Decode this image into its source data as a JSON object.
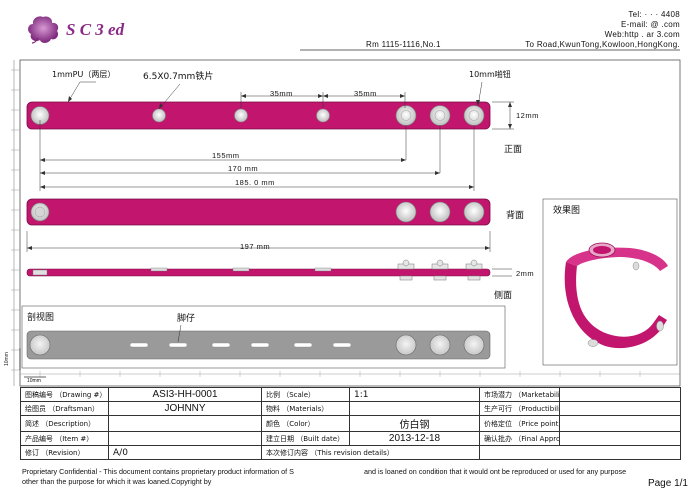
{
  "header": {
    "brand": "S        C  3    ed",
    "tel": "Tel:  ·  · ·        4408",
    "email": "E-mail:    @    .com",
    "web": "Web:http    .      ar     3.com",
    "address_room": "Rm 1115-1116,No.1",
    "address_road": "To Road,KwunTong,Kowloon,HongKong."
  },
  "drawing": {
    "label_pu": "1mmPU（两层）",
    "label_plate": "6.5X0.7mm铁片",
    "label_button": "10mm啪钮",
    "dim_35a": "35mm",
    "dim_35b": "35mm",
    "dim_12": "12mm",
    "dim_155": "155mm",
    "dim_170": "170 mm",
    "dim_185": "185. 0 mm",
    "dim_197": "197 mm",
    "dim_2": "2mm",
    "view_front": "正面",
    "view_back": "背面",
    "view_side": "侧面",
    "view_section": "剖视图",
    "label_feet": "脚仔",
    "effect_title": "效果图",
    "scale_10mm_v": "10mm",
    "scale_10mm_h": "10mm"
  },
  "title_block": {
    "drawing_no_label": "图稿编号 （Drawing #）",
    "drawing_no": "ASI3-HH-0001",
    "scale_label": "比例 （Scale）",
    "scale": "1:1",
    "market_label": "市场潜力 （Marketability）",
    "market": "",
    "draftsman_label": "绘图员 （Draftsman）",
    "draftsman": "JOHNNY",
    "materials_label": "物料 （Materials）",
    "materials": "",
    "product_label": "生产可行 （Productibility）",
    "product": "",
    "desc_label": "简述 （Description）",
    "desc": "",
    "color_label": "颜色 （Color）",
    "color": "仿白钢",
    "price_label": "价格定位 （Price point）",
    "price": "",
    "item_label": "产品编号 （Item #）",
    "item": "",
    "date_label": "建立日期 （Built date）",
    "date": "2013-12-18",
    "approval_label": "确认批办 （Final Approval）",
    "approval": "",
    "revision_label": "修订 （Revision）",
    "revision": "A/0",
    "revdetails_label": "本次修订内容 （This revision details）",
    "revdetails": ""
  },
  "footer": {
    "line1a": "Proprietary Confidential - This document contains proprietary product information of S",
    "line1b": "and is loaned on condition that it would ont be reproduced or used for any purpose",
    "line2": "other than the purpose for which it was loaned.Copyright by",
    "page": "Page 1/1"
  },
  "colors": {
    "strap": "#c2156e",
    "strap_dark": "#9a0d56",
    "gray_strap": "#9a9a9a",
    "brand": "#8a2a86"
  }
}
